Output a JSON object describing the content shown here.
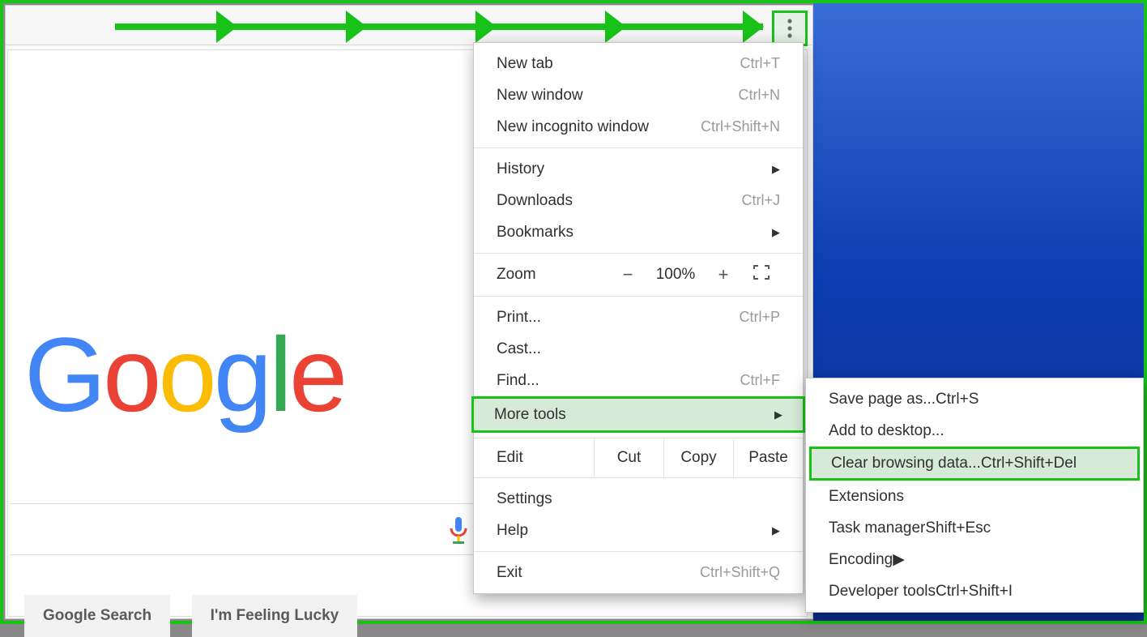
{
  "logo_letters": [
    "G",
    "o",
    "o",
    "g",
    "l",
    "e"
  ],
  "buttons": {
    "search": "Google Search",
    "lucky": "I'm Feeling Lucky"
  },
  "menu": {
    "new_tab": {
      "label": "New tab",
      "shortcut": "Ctrl+T"
    },
    "new_window": {
      "label": "New window",
      "shortcut": "Ctrl+N"
    },
    "new_incognito": {
      "label": "New incognito window",
      "shortcut": "Ctrl+Shift+N"
    },
    "history": {
      "label": "History"
    },
    "downloads": {
      "label": "Downloads",
      "shortcut": "Ctrl+J"
    },
    "bookmarks": {
      "label": "Bookmarks"
    },
    "zoom": {
      "label": "Zoom",
      "minus": "−",
      "value": "100%",
      "plus": "+"
    },
    "print": {
      "label": "Print...",
      "shortcut": "Ctrl+P"
    },
    "cast": {
      "label": "Cast..."
    },
    "find": {
      "label": "Find...",
      "shortcut": "Ctrl+F"
    },
    "more_tools": {
      "label": "More tools"
    },
    "edit": {
      "label": "Edit",
      "cut": "Cut",
      "copy": "Copy",
      "paste": "Paste"
    },
    "settings": {
      "label": "Settings"
    },
    "help": {
      "label": "Help"
    },
    "exit": {
      "label": "Exit",
      "shortcut": "Ctrl+Shift+Q"
    }
  },
  "submenu": {
    "save_page": {
      "label": "Save page as...",
      "shortcut": "Ctrl+S"
    },
    "add_desktop": {
      "label": "Add to desktop..."
    },
    "clear_data": {
      "label": "Clear browsing data...",
      "shortcut": "Ctrl+Shift+Del"
    },
    "extensions": {
      "label": "Extensions"
    },
    "task_manager": {
      "label": "Task manager",
      "shortcut": "Shift+Esc"
    },
    "encoding": {
      "label": "Encoding"
    },
    "dev_tools": {
      "label": "Developer tools",
      "shortcut": "Ctrl+Shift+I"
    }
  }
}
